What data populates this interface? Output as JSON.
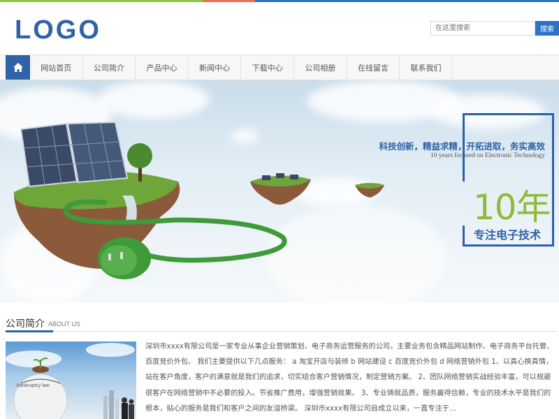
{
  "brand": {
    "logo_text": "LOGO"
  },
  "colors": {
    "accent": "#2f62a6",
    "green": "#8dbb3c",
    "top_bar": [
      "#8dc63f",
      "#f26c4f",
      "#2b72c8"
    ]
  },
  "search": {
    "placeholder": "在这里搜索",
    "button_label": "搜索"
  },
  "nav": {
    "home_icon": "home-icon",
    "items": [
      "网站首页",
      "公司简介",
      "产品中心",
      "新闻中心",
      "下载中心",
      "公司相册",
      "在线留言",
      "联系我们"
    ]
  },
  "banner": {
    "slogan": "科技创新，精益求精，开拓进取，务实高效",
    "slogan_en": "10 years focused on Electronic Technology",
    "years": "10年",
    "years_sub": "专注电子技术"
  },
  "about": {
    "title": "公司简介",
    "title_en": "ABOUT US",
    "image_text": "bankruptcy law",
    "text": "深圳市xxxx有限公司是一家专业从事企业营销策划、电子商务运营服务的公司，主要业务包含精品网站制作、电子商务平台托管、百度竞价外包、 我们主要提供以下几点服务： a 淘宝开店与装修 b 网站建设 c 百度竞价外包 d 网络营销外包 1、以真心换真情，站在客户角度，客户的满意就是我们的追求，切实结合客户营销情况，制定营销方案。 2、团队网络营销实战经验丰富，可以规避很客户在网络营销中不必要的投入。节省推广费用，增强营销效果。 3、专业铸就品质，服务赢得信赖，专业的技术水平是我们的根本，贴心的服务是我们和客户之间的友谊桥梁。 深圳市xxxx有限公司自成立以来，一直专注于..."
  }
}
